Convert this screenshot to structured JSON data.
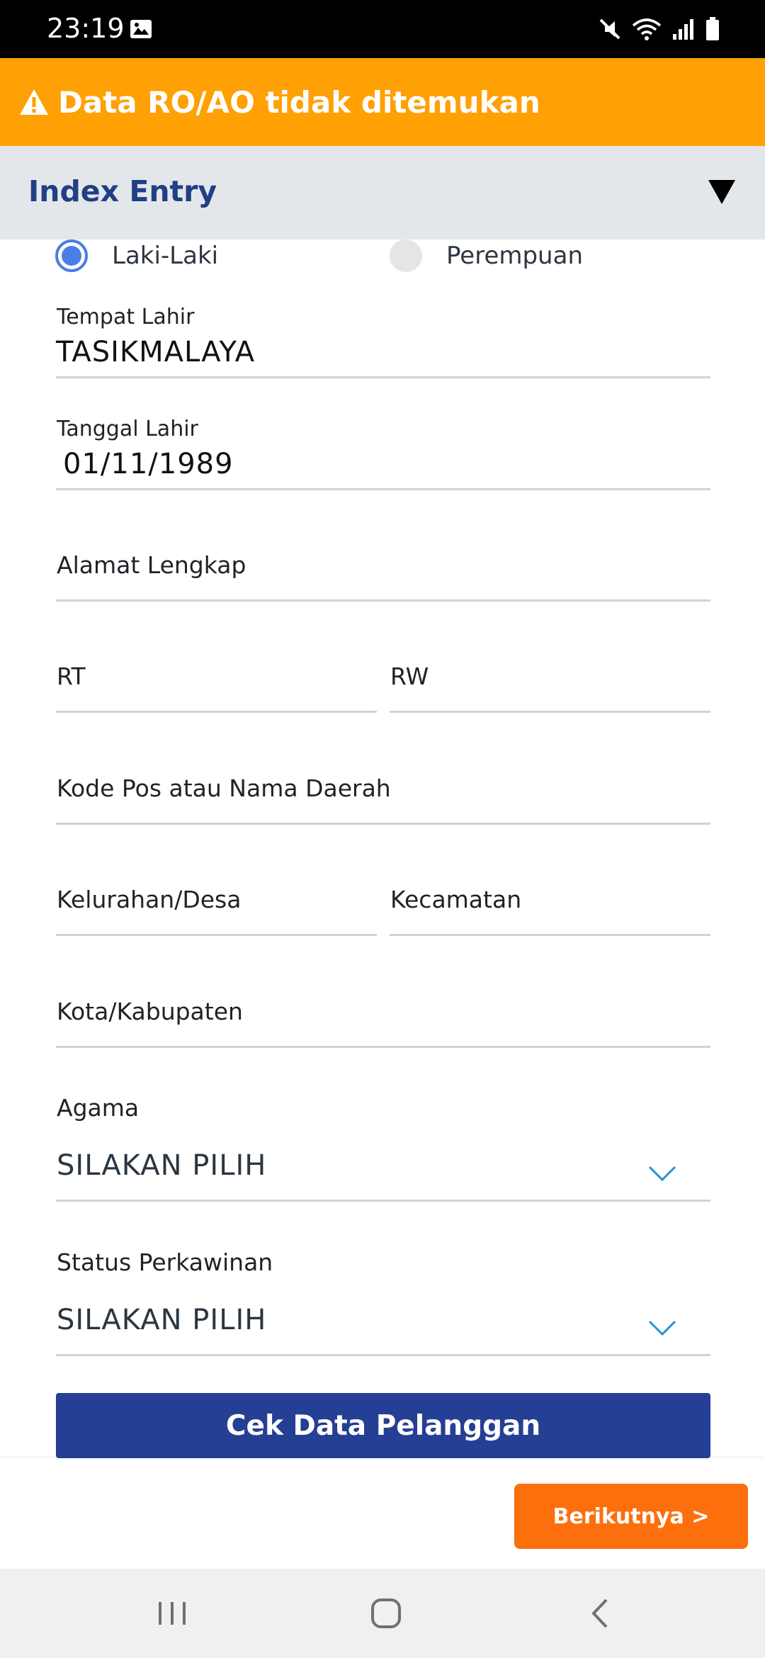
{
  "status_bar": {
    "time": "23:19",
    "left_icons": [
      "gallery-icon"
    ],
    "right_icons": [
      "mute-icon",
      "wifi-icon",
      "signal-icon",
      "battery-icon"
    ]
  },
  "warning": {
    "text": "Data RO/AO tidak ditemukan",
    "icon": "warning-icon",
    "color": "#ffa005"
  },
  "section": {
    "title": "Index Entry",
    "toggle_icon": "caret-down-icon"
  },
  "form": {
    "gender": {
      "options": [
        {
          "label": "Laki-Laki",
          "selected": true
        },
        {
          "label": "Perempuan",
          "selected": false
        }
      ]
    },
    "tempat_lahir": {
      "label": "Tempat Lahir",
      "value": "TASIKMALAYA"
    },
    "tanggal_lahir": {
      "label": "Tanggal Lahir",
      "value": "01/11/1989"
    },
    "alamat": {
      "placeholder": "Alamat Lengkap"
    },
    "rt": {
      "placeholder": "RT"
    },
    "rw": {
      "placeholder": "RW"
    },
    "kode_pos": {
      "placeholder": "Kode Pos atau Nama Daerah"
    },
    "kelurahan": {
      "placeholder": "Kelurahan/Desa"
    },
    "kecamatan": {
      "placeholder": "Kecamatan"
    },
    "kota": {
      "placeholder": "Kota/Kabupaten"
    },
    "agama": {
      "label": "Agama",
      "value": "SILAKAN PILIH"
    },
    "status_perkawinan": {
      "label": "Status Perkawinan",
      "value": "SILAKAN PILIH"
    },
    "check_button": "Cek Data Pelanggan"
  },
  "actions": {
    "next_button": "Berikutnya >"
  },
  "navigation": [
    "recent-apps-icon",
    "home-icon",
    "back-icon"
  ],
  "colors": {
    "primary": "#243f94",
    "accent": "#fd6f0d",
    "title": "#203f84",
    "radio": "#4a7ee8",
    "chevron": "#2a8fd6"
  }
}
